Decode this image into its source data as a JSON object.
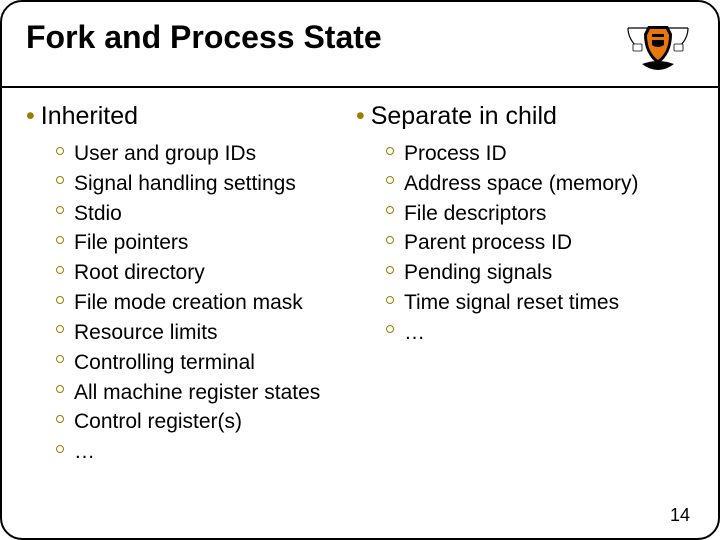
{
  "title": "Fork and Process State",
  "left": {
    "heading": "Inherited",
    "items": [
      "User and group IDs",
      "Signal handling settings",
      "Stdio",
      "File pointers",
      "Root directory",
      "File mode creation mask",
      "Resource limits",
      "Controlling terminal",
      "All machine register states",
      "Control register(s)",
      "…"
    ]
  },
  "right": {
    "heading": "Separate in child",
    "items": [
      "Process ID",
      "Address space (memory)",
      "File descriptors",
      "Parent process ID",
      "Pending signals",
      "Time signal reset times",
      "…"
    ]
  },
  "page_number": "14"
}
